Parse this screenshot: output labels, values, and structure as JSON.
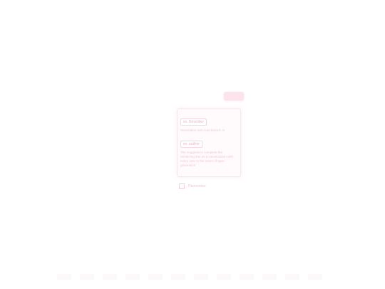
{
  "header": {
    "badge_label": "add"
  },
  "card": {
    "items": [
      {
        "chip": "ex. Nova'dev",
        "description": "Generation-sort Auto-branch AI"
      },
      {
        "chip": "ex. outline",
        "description": "The suggests to complete the remaining text as a conversation with every user to the users-of-type-generation"
      }
    ]
  },
  "footer": {
    "checkbox_label": "Remember"
  }
}
